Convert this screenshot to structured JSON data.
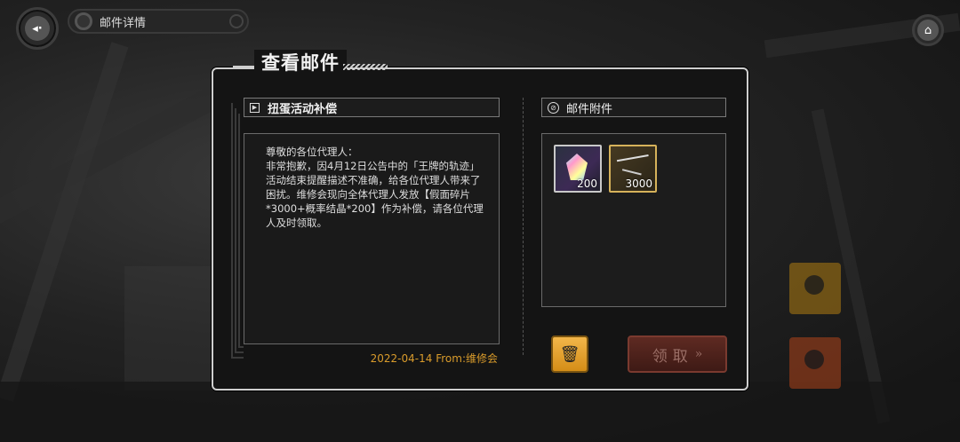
{
  "header": {
    "back_icon": "back-arrow-icon",
    "title": "邮件详情",
    "home_icon": "home-icon"
  },
  "dialog": {
    "title": "查看邮件"
  },
  "mail": {
    "subject": "扭蛋活动补偿",
    "body": "尊敬的各位代理人：\n非常抱歉，因4月12日公告中的「王牌的轨迹」活动结束提醒描述不准确，给各位代理人带来了困扰。维修会现向全体代理人发放【假面碎片*3000+概率结晶*200】作为补偿，请各位代理人及时领取。",
    "date": "2022-04-14",
    "from": "From:维修会"
  },
  "attachments": {
    "title": "邮件附件",
    "items": [
      {
        "icon": "crystal-icon",
        "count": "200"
      },
      {
        "icon": "mask-shard-icon",
        "count": "3000"
      }
    ]
  },
  "actions": {
    "delete_icon": "trash-icon",
    "claim_label": "领取",
    "claim_arrow": "»"
  },
  "colors": {
    "accent_orange": "#f2b64a",
    "date_text": "#d99b2b",
    "claim_bg": "#5e2a22"
  }
}
